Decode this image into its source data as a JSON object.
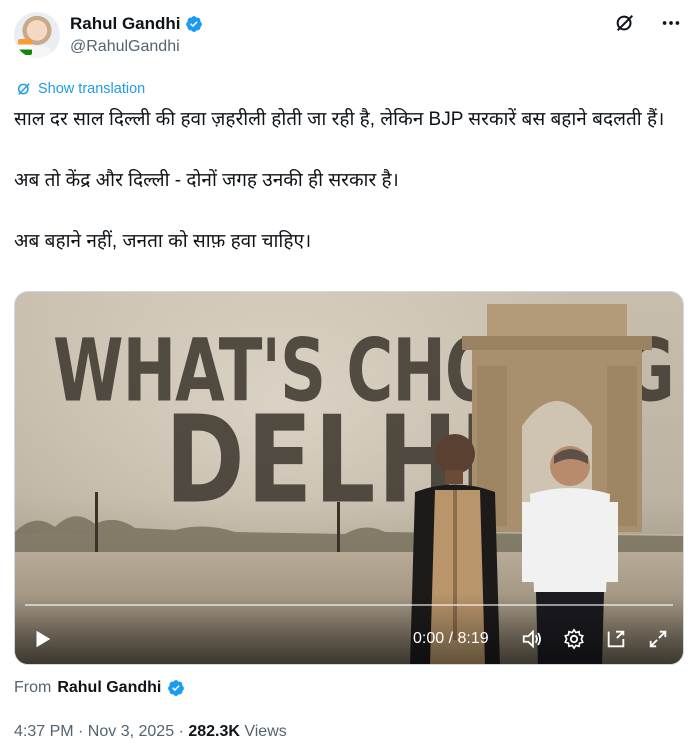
{
  "author": {
    "name": "Rahul Gandhi",
    "handle": "@RahulGandhi"
  },
  "icons": {
    "verified": "verified-badge-icon",
    "grok": "grok-icon",
    "more": "more-icon",
    "translate": "translate-icon"
  },
  "translate_label": "Show translation",
  "tweet": {
    "line1": "साल दर साल दिल्ली की हवा ज़हरीली होती जा रही है, लेकिन BJP सरकारें बस बहाने बदलती हैं।",
    "line2": "अब तो केंद्र और दिल्ली - दोनों जगह उनकी ही सरकार है।",
    "line3": "अब बहाने नहीं, जनता को साफ़ हवा चाहिए।"
  },
  "video": {
    "headline_top": "WHAT'S CHOKING",
    "headline_bottom": "DELHI?",
    "time": "0:00 / 8:19",
    "progress": 0.0
  },
  "from_label": "From",
  "from_name": "Rahul Gandhi",
  "timestamp": "4:37 PM · Nov 3, 2025 · ",
  "views_count": "282.3K",
  "views_label": " Views",
  "colors": {
    "accent": "#1d9bf0",
    "text": "#0f1419",
    "secondary": "#536471"
  }
}
